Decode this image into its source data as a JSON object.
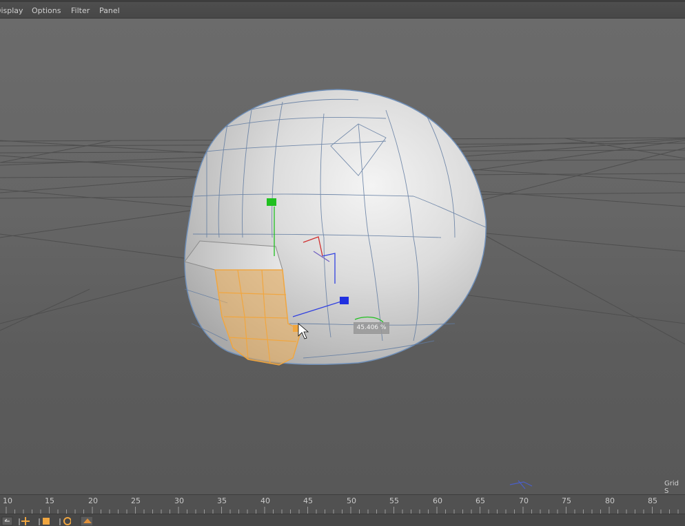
{
  "menu": {
    "items": [
      "Display",
      "Options",
      "Filter",
      "Panel"
    ]
  },
  "viewport": {
    "scale_readout": "45.406 %",
    "grid_label": "Grid S",
    "colors": {
      "background": "#666666",
      "sphere": "#d8d8d8",
      "selection": "#f0a640",
      "axis_x": "#d03030",
      "axis_y": "#20c020",
      "axis_z": "#3040e0",
      "wireframe": "#5a7ca8"
    }
  },
  "timeline": {
    "ticks": [
      "10",
      "15",
      "20",
      "25",
      "30",
      "35",
      "40",
      "45",
      "50",
      "55",
      "60",
      "65",
      "70",
      "75",
      "80",
      "85"
    ]
  },
  "toolbar": {
    "icons": [
      "undo-icon",
      "move-icon",
      "scale-icon",
      "rotate-icon",
      "render-icon"
    ]
  }
}
